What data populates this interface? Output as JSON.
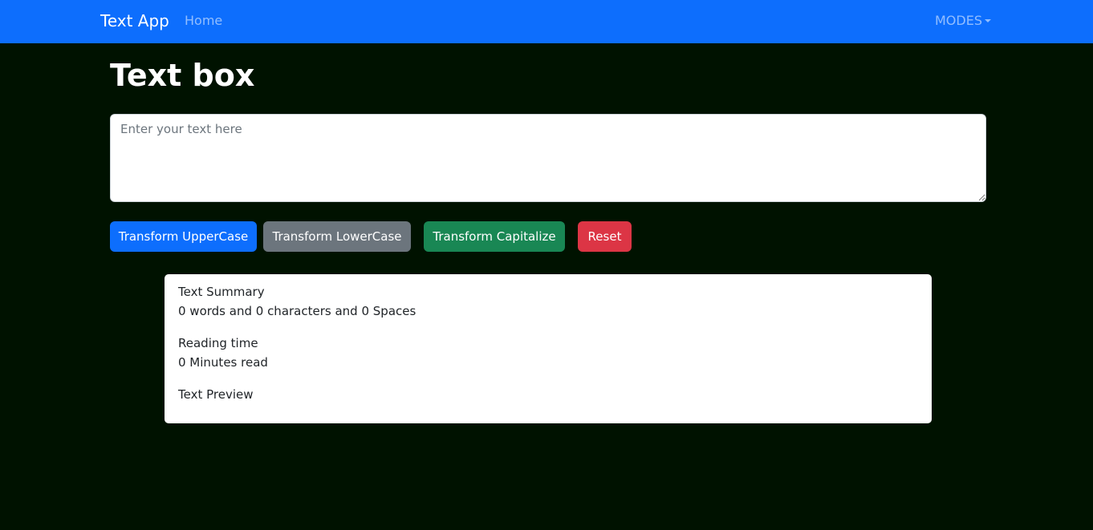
{
  "navbar": {
    "brand": "Text App",
    "home": "Home",
    "modes": "MODES",
    "bg_color": "#0d6efd"
  },
  "main": {
    "title": "Text box",
    "textarea": {
      "placeholder": "Enter your text here",
      "value": ""
    },
    "buttons": {
      "upper": "Transform UpperCase",
      "lower": "Transform LowerCase",
      "capitalize": "Transform Capitalize",
      "reset": "Reset"
    },
    "bg_color": "#001200"
  },
  "summary": {
    "heading": "Text Summary",
    "counts": "0 words and 0 characters and 0 Spaces",
    "reading_heading": "Reading time",
    "reading_value": "0 Minutes read",
    "preview_heading": "Text Preview"
  }
}
